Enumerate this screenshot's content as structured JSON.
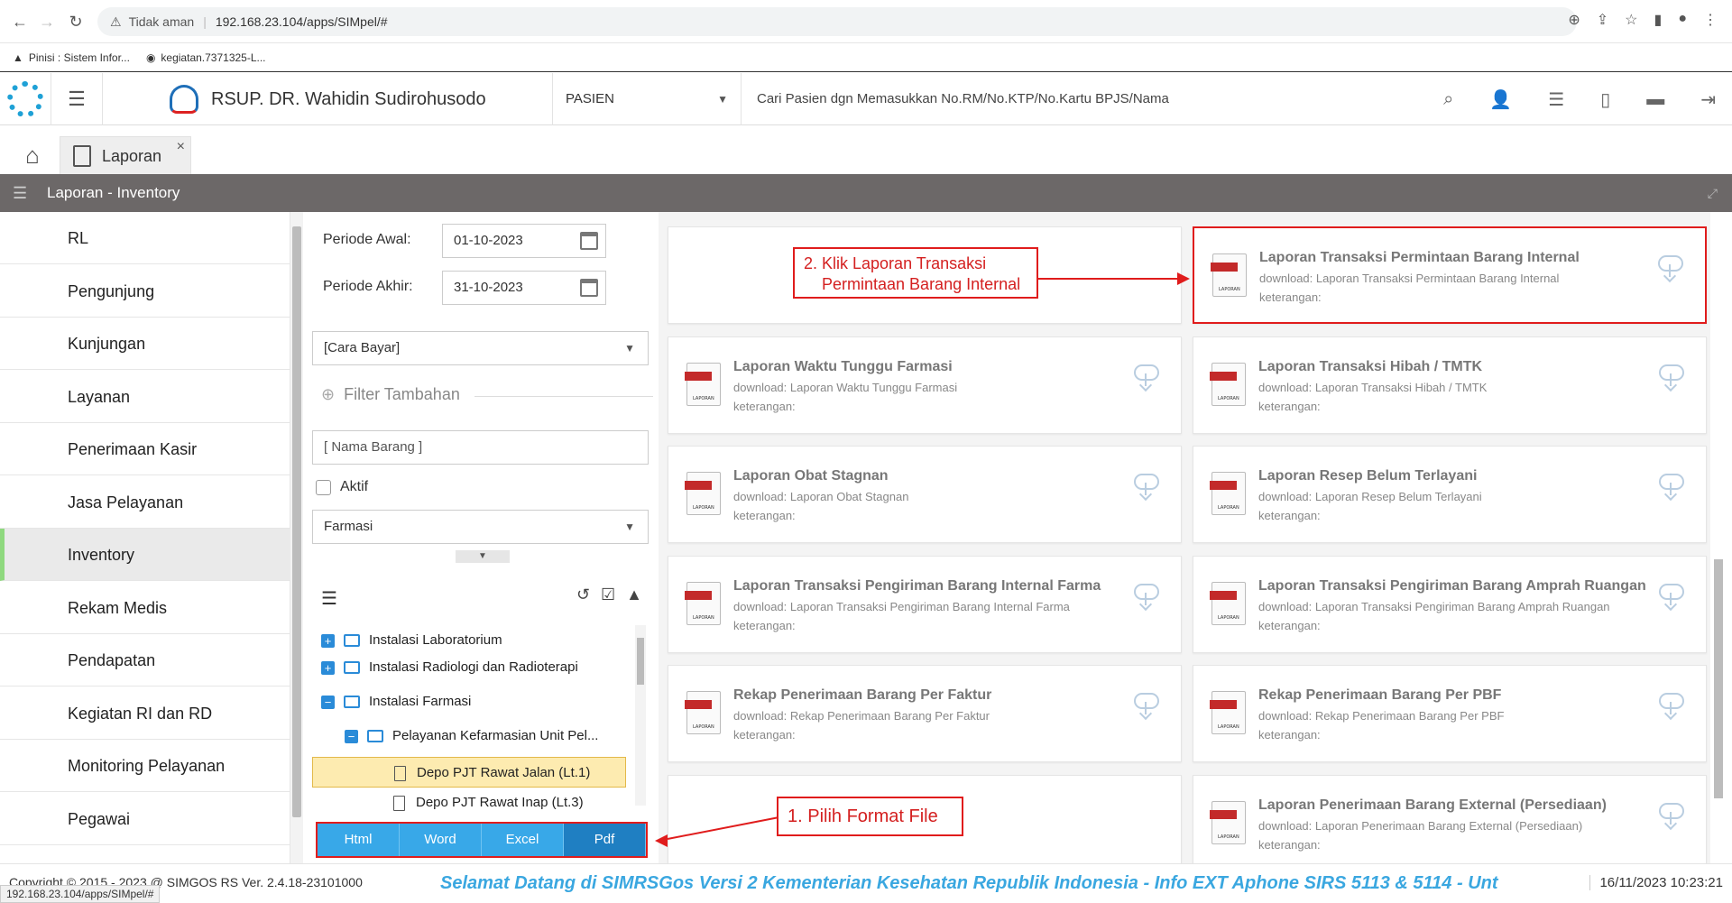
{
  "browser": {
    "security_label": "Tidak aman",
    "url": "192.168.23.104/apps/SIMpel/#",
    "bookmarks": [
      "Pinisi : Sistem Infor...",
      "kegiatan.7371325-L..."
    ],
    "status_url": "192.168.23.104/apps/SIMpel/#"
  },
  "header": {
    "hospital_name": "RSUP. DR. Wahidin Sudirohusodo",
    "search_category": "PASIEN",
    "search_placeholder": "Cari Pasien dgn Memasukkan No.RM/No.KTP/No.Kartu BPJS/Nama"
  },
  "tabs": {
    "active_label": "Laporan"
  },
  "panel": {
    "title": "Laporan - Inventory"
  },
  "sidebar": {
    "items": [
      {
        "label": "RL"
      },
      {
        "label": "Pengunjung"
      },
      {
        "label": "Kunjungan"
      },
      {
        "label": "Layanan"
      },
      {
        "label": "Penerimaan Kasir"
      },
      {
        "label": "Jasa Pelayanan"
      },
      {
        "label": "Inventory"
      },
      {
        "label": "Rekam Medis"
      },
      {
        "label": "Pendapatan"
      },
      {
        "label": "Kegiatan RI dan RD"
      },
      {
        "label": "Monitoring Pelayanan"
      },
      {
        "label": "Pegawai"
      }
    ],
    "active_index": 6
  },
  "filter": {
    "periode_awal_label": "Periode Awal:",
    "periode_awal_value": "01-10-2023",
    "periode_akhir_label": "Periode Akhir:",
    "periode_akhir_value": "31-10-2023",
    "cara_bayar": "[Cara Bayar]",
    "filter_tambahan": "Filter Tambahan",
    "nama_barang_placeholder": "[ Nama Barang ]",
    "aktif_label": "Aktif",
    "unit_value": "Farmasi",
    "tree": [
      {
        "label": "Instalasi Laboratorium",
        "toggle": "+"
      },
      {
        "label": "Instalasi Radiologi dan Radioterapi",
        "toggle": "+"
      },
      {
        "label": "Instalasi Farmasi",
        "toggle": "−"
      },
      {
        "label": "Pelayanan Kefarmasian Unit Pel...",
        "toggle": "−"
      },
      {
        "label": "Depo PJT Rawat Jalan (Lt.1)"
      },
      {
        "label": "Depo PJT Rawat Inap (Lt.3)"
      }
    ],
    "formats": [
      "Html",
      "Word",
      "Excel",
      "Pdf"
    ]
  },
  "reports": [
    {
      "title": "Laporan Transaksi Permintaan Barang Internal",
      "download": "download: Laporan Transaksi Permintaan Barang Internal",
      "ket": "keterangan:"
    },
    {
      "title": "Laporan Waktu Tunggu Farmasi",
      "download": "download: Laporan Waktu Tunggu Farmasi",
      "ket": "keterangan:"
    },
    {
      "title": "Laporan Transaksi Hibah / TMTK",
      "download": "download: Laporan Transaksi Hibah / TMTK",
      "ket": "keterangan:"
    },
    {
      "title": "Laporan Obat Stagnan",
      "download": "download: Laporan Obat Stagnan",
      "ket": "keterangan:"
    },
    {
      "title": "Laporan Resep Belum Terlayani",
      "download": "download: Laporan Resep Belum Terlayani",
      "ket": "keterangan:"
    },
    {
      "title": "Laporan Transaksi Pengiriman Barang Internal Farma",
      "download": "download: Laporan Transaksi Pengiriman Barang Internal Farma",
      "ket": "keterangan:"
    },
    {
      "title": "Laporan Transaksi Pengiriman Barang Amprah Ruangan",
      "download": "download: Laporan Transaksi Pengiriman Barang Amprah Ruangan",
      "ket": "keterangan:"
    },
    {
      "title": "Rekap Penerimaan Barang Per Faktur",
      "download": "download: Rekap Penerimaan Barang Per Faktur",
      "ket": "keterangan:"
    },
    {
      "title": "Rekap Penerimaan Barang Per PBF",
      "download": "download: Rekap Penerimaan Barang Per PBF",
      "ket": "keterangan:"
    },
    {
      "title": "Laporan Penerimaan Barang External (Persediaan)",
      "download": "download: Laporan Penerimaan Barang External (Persediaan)",
      "ket": "keterangan:"
    }
  ],
  "annotations": {
    "step2_line1": "2. Klik Laporan Transaksi",
    "step2_line2": "Permintaan Barang Internal",
    "step1": "1. Pilih Format File"
  },
  "footer": {
    "copyright": "Copyright © 2015 - 2023 @ SIMGOS RS Ver. 2.4.18-23101000",
    "ticker": "Selamat Datang di SIMRSGos Versi 2 Kementerian Kesehatan Republik Indonesia - Info EXT Aphone SIRS 5113 & 5114 - Unt",
    "datetime": "16/11/2023 10:23:21"
  },
  "colors": {
    "annotation_red": "#e01c1c",
    "format_blue": "#38a8e8",
    "panel_header": "#6c6868",
    "ticker_blue": "#3aa7e0"
  }
}
